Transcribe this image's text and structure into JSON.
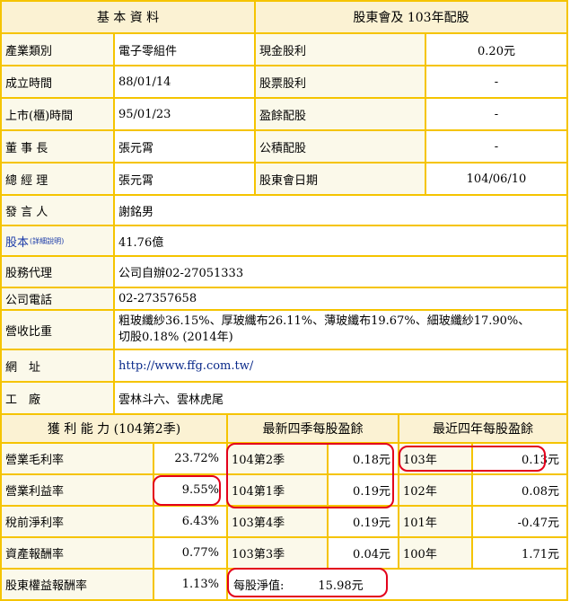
{
  "basic": {
    "header": "基 本 資 料",
    "rows": [
      {
        "label": "產業類別",
        "value": "電子零組件"
      },
      {
        "label": "成立時間",
        "value": "88/01/14"
      },
      {
        "label": "上市(櫃)時間",
        "value": "95/01/23"
      },
      {
        "label": "董 事 長",
        "value": "張元霄"
      },
      {
        "label": "總 經 理",
        "value": "張元霄"
      },
      {
        "label": "發 言 人",
        "value": "謝銘男"
      },
      {
        "label": "股本",
        "note": "(詳細說明)",
        "value": "41.76億"
      },
      {
        "label": "股務代理",
        "value": "公司自辦02-27051333"
      },
      {
        "label": "公司電話",
        "value": "02-27357658"
      },
      {
        "label": "營收比重",
        "value": "粗玻纖紗36.15%、厚玻纖布26.11%、薄玻纖布19.67%、細玻纖紗17.90%、切股0.18% (2014年)"
      },
      {
        "label": "網　址",
        "value": "http://www.ffg.com.tw/"
      },
      {
        "label": "工　廠",
        "value": "雲林斗六、雲林虎尾"
      }
    ]
  },
  "dividend": {
    "header": "股東會及 103年配股",
    "rows": [
      {
        "label": "現金股利",
        "value": "0.20元"
      },
      {
        "label": "股票股利",
        "value": "-"
      },
      {
        "label": "盈餘配股",
        "value": "-"
      },
      {
        "label": "公積配股",
        "value": "-"
      },
      {
        "label": "股東會日期",
        "value": "104/06/10"
      }
    ]
  },
  "profit": {
    "header": "獲 利 能 力 (104第2季)",
    "rows": [
      {
        "label": "營業毛利率",
        "value": "23.72%"
      },
      {
        "label": "營業利益率",
        "value": "9.55%"
      },
      {
        "label": "稅前淨利率",
        "value": "6.43%"
      },
      {
        "label": "資產報酬率",
        "value": "0.77%"
      },
      {
        "label": "股東權益報酬率",
        "value": "1.13%"
      }
    ]
  },
  "eps_quarter": {
    "header": "最新四季每股盈餘",
    "rows": [
      {
        "label": "104第2季",
        "value": "0.18元"
      },
      {
        "label": "104第1季",
        "value": "0.19元"
      },
      {
        "label": "103第4季",
        "value": "0.19元"
      },
      {
        "label": "103第3季",
        "value": "0.04元"
      }
    ],
    "nav_label": "每股淨值:",
    "nav_value": "15.98元"
  },
  "eps_year": {
    "header": "最近四年每股盈餘",
    "rows": [
      {
        "label": "103年",
        "value": "0.13元"
      },
      {
        "label": "102年",
        "value": "0.08元"
      },
      {
        "label": "101年",
        "value": "-0.47元"
      },
      {
        "label": "100年",
        "value": "1.71元"
      }
    ]
  },
  "colors": {
    "border": "#f5c400",
    "header_bg": "#fbf2d3",
    "highlight": "#e3001b",
    "link": "#1a3aa8"
  }
}
